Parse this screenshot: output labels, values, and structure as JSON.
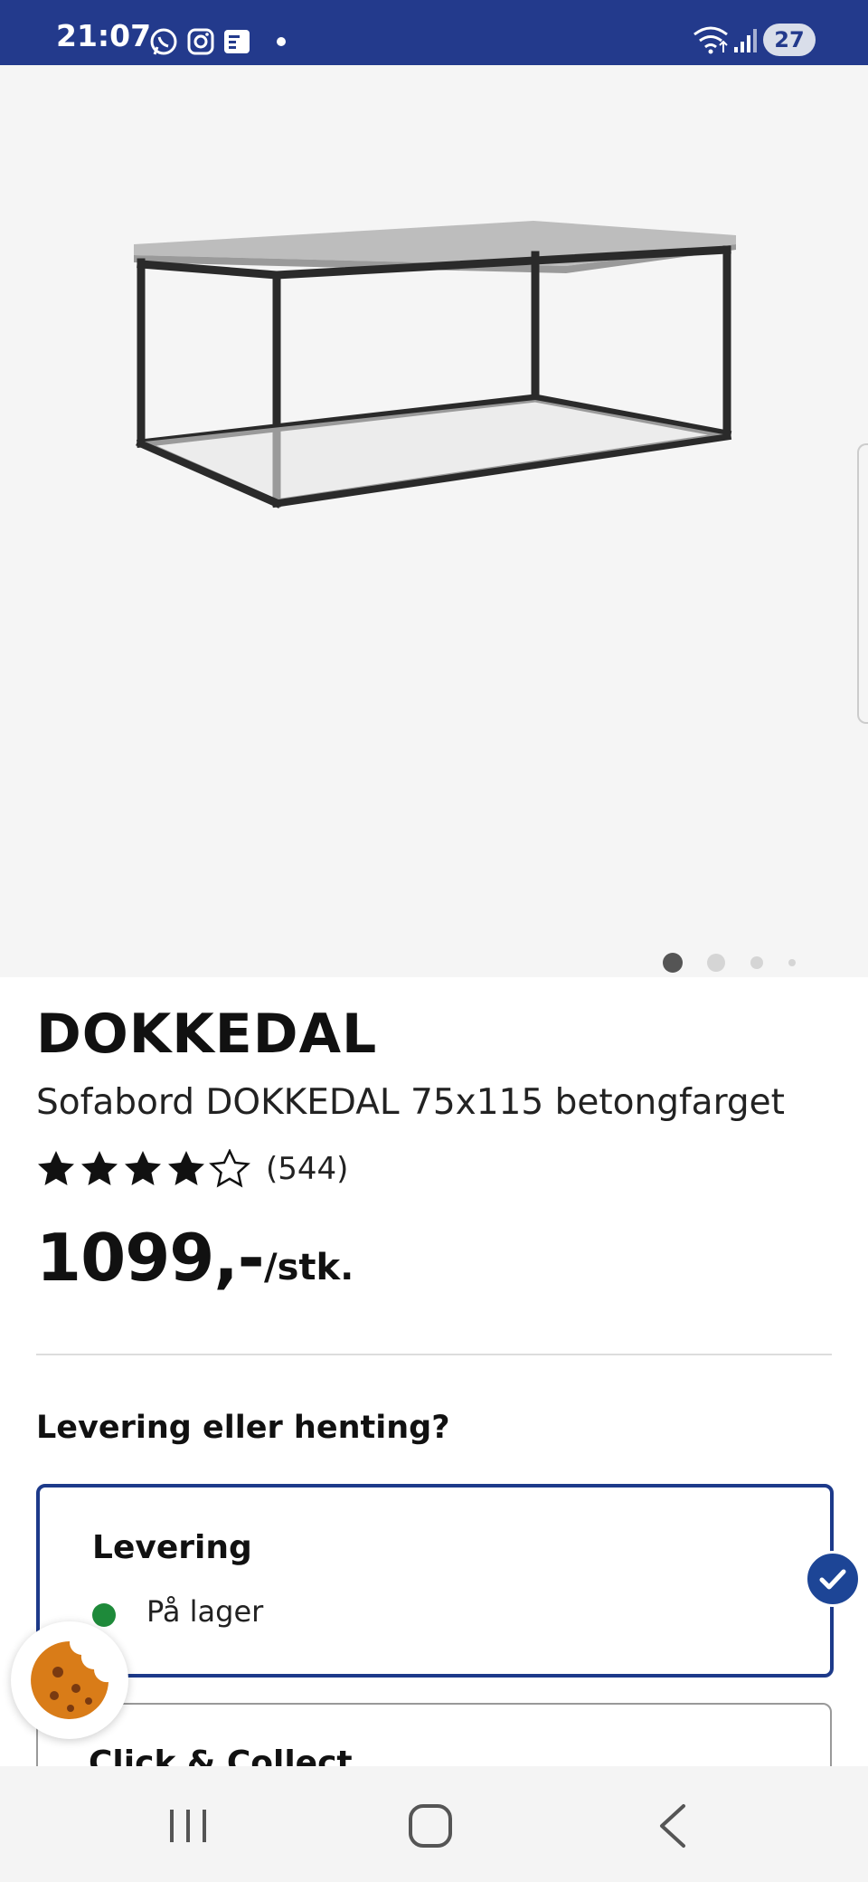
{
  "status_bar": {
    "time": "21:07",
    "battery_level": "27",
    "left_icons": [
      "whatsapp-icon",
      "instagram-icon",
      "news-icon",
      "dot-icon"
    ],
    "right_icons": [
      "wifi-icon",
      "signal-icon",
      "battery-icon"
    ],
    "background_color": "#233a8c"
  },
  "product": {
    "image_icon": "coffee-table-image",
    "carousel_dots_count": 4,
    "carousel_active_index": 0,
    "brand": "DOKKEDAL",
    "description": "Sofabord DOKKEDAL 75x115 betongfarget",
    "rating_stars": 4,
    "rating_max": 5,
    "rating_count": "(544)",
    "price": "1099,-",
    "price_unit": "/stk."
  },
  "delivery": {
    "question": "Levering eller henting?",
    "options": [
      {
        "title": "Levering",
        "stock_label": "På lager",
        "selected": true,
        "status_color": "#1e8a3a"
      },
      {
        "title": "Click & Collect",
        "selected": false
      }
    ],
    "accent_color": "#1d3a8a"
  },
  "cookie_button": {
    "icon": "cookie-icon"
  },
  "nav_bar": {
    "buttons": [
      "recent-apps-icon",
      "home-icon",
      "back-icon"
    ]
  }
}
